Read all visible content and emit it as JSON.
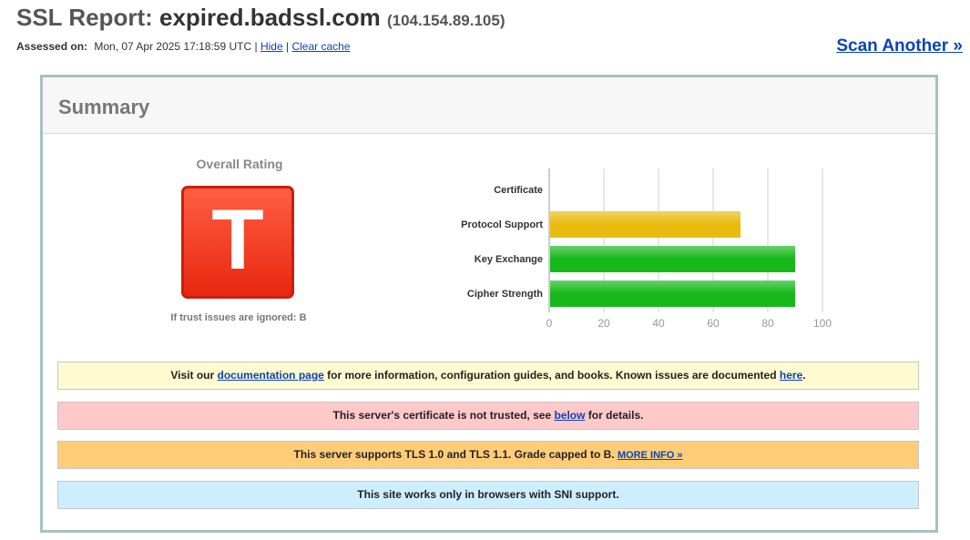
{
  "header": {
    "title_prefix": "SSL Report: ",
    "host": "expired.badssl.com",
    "ip": "(104.154.89.105)",
    "assessed_label": "Assessed on:",
    "assessed_value": "Mon, 07 Apr 2025 17:18:59 UTC",
    "separator": "|",
    "hide_link": "Hide",
    "clear_cache_link": "Clear cache",
    "scan_another": "Scan Another »"
  },
  "summary": {
    "title": "Summary",
    "overall_rating_label": "Overall Rating",
    "grade": "T",
    "grade_color": "#e8270f",
    "trust_note": "If trust issues are ignored: B"
  },
  "chart_data": {
    "type": "bar",
    "orientation": "horizontal",
    "categories": [
      "Certificate",
      "Protocol Support",
      "Key Exchange",
      "Cipher Strength"
    ],
    "values": [
      0,
      70,
      90,
      90
    ],
    "colors": [
      "#cccccc",
      "#e8bb0e",
      "#16b81a",
      "#16b81a"
    ],
    "ticks": [
      "0",
      "20",
      "40",
      "60",
      "80",
      "100"
    ],
    "xlim": [
      0,
      100
    ],
    "grid": true
  },
  "notices": {
    "doc": {
      "pre": "Visit our ",
      "link1": "documentation page",
      "mid": " for more information, configuration guides, and books. Known issues are documented ",
      "link2": "here",
      "post": "."
    },
    "cert": {
      "pre": "This server's certificate is not trusted, see ",
      "link": "below",
      "post": " for details."
    },
    "tls": {
      "text": "This server supports TLS 1.0 and TLS 1.1. Grade capped to B. ",
      "link": "MORE INFO »"
    },
    "sni": {
      "text": "This site works only in browsers with SNI support."
    }
  }
}
